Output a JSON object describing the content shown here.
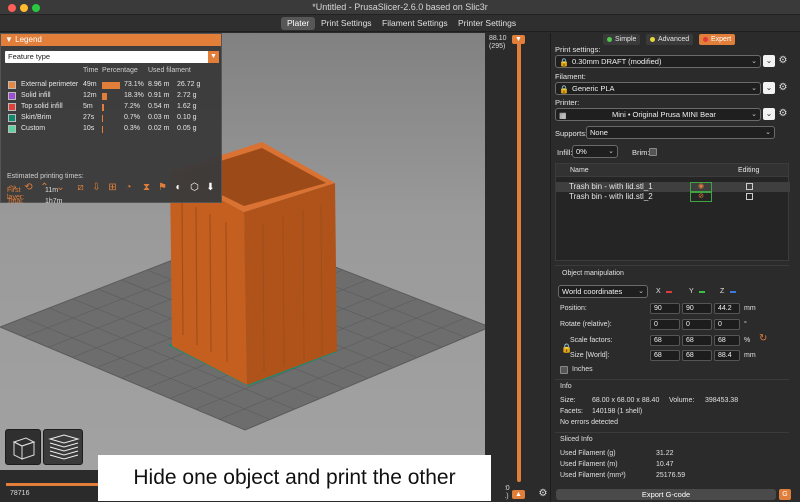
{
  "window": {
    "title": "*Untitled - PrusaSlicer-2.6.0 based on Slic3r"
  },
  "tabs": [
    {
      "label": "Plater",
      "active": true
    },
    {
      "label": "Print Settings",
      "active": false
    },
    {
      "label": "Filament Settings",
      "active": false
    },
    {
      "label": "Printer Settings",
      "active": false
    }
  ],
  "legend": {
    "title": "Legend",
    "view_type": "Feature type",
    "columns": {
      "time": "Time",
      "percentage": "Percentage",
      "used_filament": "Used filament"
    },
    "rows": [
      {
        "name": "External perimeter",
        "time": "49m",
        "percent": "73.1%",
        "fraction": 0.731,
        "length": "8.96 m",
        "weight": "26.72 g",
        "color": "#e8873f"
      },
      {
        "name": "Solid infill",
        "time": "12m",
        "percent": "18.3%",
        "fraction": 0.183,
        "length": "0.91 m",
        "weight": "2.72 g",
        "color": "#9a4fd0"
      },
      {
        "name": "Top solid infill",
        "time": "5m",
        "percent": "7.2%",
        "fraction": 0.072,
        "length": "0.54 m",
        "weight": "1.62 g",
        "color": "#e0403a"
      },
      {
        "name": "Skirt/Brim",
        "time": "27s",
        "percent": "0.7%",
        "fraction": 0.007,
        "length": "0.03 m",
        "weight": "0.10 g",
        "color": "#108a6e"
      },
      {
        "name": "Custom",
        "time": "10s",
        "percent": "0.3%",
        "fraction": 0.003,
        "length": "0.02 m",
        "weight": "0.05 g",
        "color": "#5ed3a0"
      }
    ],
    "estimated_label": "Estimated printing times:",
    "first_layer_label": "First layer:",
    "first_layer_value": "11m",
    "total_label": "Total:",
    "total_value": "1h7m"
  },
  "vslider": {
    "top_value": "88.10",
    "top_layer": "(295)",
    "bottom_value": "0.20",
    "bottom_layer": "(1)"
  },
  "hslider": {
    "value": "78716"
  },
  "sidebar": {
    "modes": [
      {
        "label": "Simple",
        "color": "#4ec94e",
        "active": false
      },
      {
        "label": "Advanced",
        "color": "#e8d63a",
        "active": false
      },
      {
        "label": "Expert",
        "color": "#e03a3a",
        "active": true
      }
    ],
    "print_settings_label": "Print settings:",
    "print_settings_value": "0.30mm DRAFT (modified)",
    "filament_label": "Filament:",
    "filament_value": "Generic PLA",
    "printer_label": "Printer:",
    "printer_value": "Mini • Original Prusa MINI Bear",
    "supports_label": "Supports:",
    "supports_value": "None",
    "infill_label": "Infill:",
    "infill_value": "0%",
    "brim_label": "Brim:",
    "objects_header": {
      "name": "Name",
      "editing": "Editing"
    },
    "objects": [
      {
        "name": "Trash bin - with lid.stl_1",
        "visible": true
      },
      {
        "name": "Trash bin - with lid.stl_2",
        "visible": false
      }
    ],
    "object_manipulation": {
      "title": "Object manipulation",
      "coords": "World coordinates",
      "axes": [
        "X",
        "Y",
        "Z"
      ],
      "position_label": "Position:",
      "position": [
        "90",
        "90",
        "44.2"
      ],
      "position_unit": "mm",
      "rotate_label": "Rotate (relative):",
      "rotate": [
        "0",
        "0",
        "0"
      ],
      "rotate_unit": "°",
      "scale_label": "Scale factors:",
      "scale": [
        "68",
        "68",
        "68"
      ],
      "scale_unit": "%",
      "size_label": "Size [World]:",
      "size": [
        "68",
        "68",
        "88.4"
      ],
      "size_unit": "mm",
      "inches_label": "Inches"
    },
    "info": {
      "title": "Info",
      "size_label": "Size:",
      "size_value": "68.00 x 68.00 x 88.40",
      "volume_label": "Volume:",
      "volume_value": "398453.38",
      "facets_label": "Facets:",
      "facets_value": "140198 (1 shell)",
      "errors": "No errors detected"
    },
    "sliced_info": {
      "title": "Sliced Info",
      "rows": [
        {
          "label": "Used Filament (g)",
          "value": "31.22"
        },
        {
          "label": "Used Filament (m)",
          "value": "10.47"
        },
        {
          "label": "Used Filament (mm³)",
          "value": "25176.59"
        }
      ]
    },
    "export_label": "Export G-code"
  },
  "caption": "Hide one object and print the other"
}
